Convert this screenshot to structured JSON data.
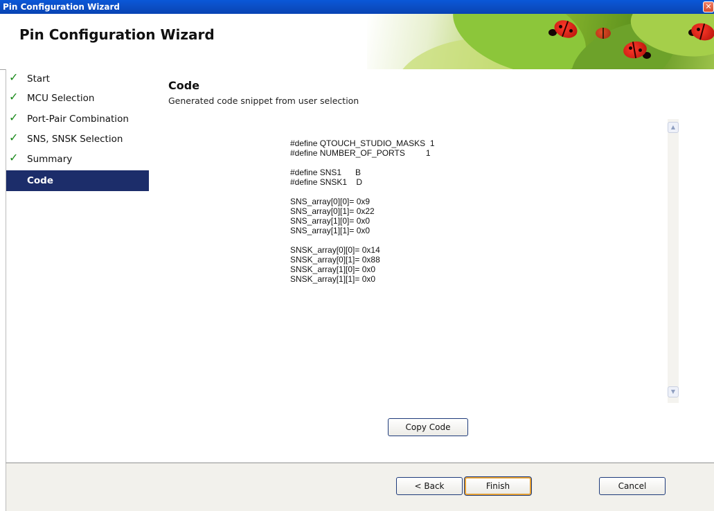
{
  "window": {
    "title": "Pin Configuration Wizard",
    "close_glyph": "✕"
  },
  "header": {
    "title": "Pin Configuration Wizard"
  },
  "nav": {
    "items": [
      {
        "label": "Start",
        "done": true
      },
      {
        "label": "MCU Selection",
        "done": true
      },
      {
        "label": "Port-Pair Combination",
        "done": true
      },
      {
        "label": "SNS, SNSK Selection",
        "done": true
      },
      {
        "label": "Summary",
        "done": true
      },
      {
        "label": "Code",
        "done": false,
        "active": true
      }
    ],
    "check_glyph": "✓",
    "active_color": "#1c2d6a"
  },
  "content": {
    "title": "Code",
    "description": "Generated code snippet from user selection",
    "code": "#define QTOUCH_STUDIO_MASKS  1\n#define NUMBER_OF_PORTS         1\n\n#define SNS1      B\n#define SNSK1    D\n\nSNS_array[0][0]= 0x9\nSNS_array[0][1]= 0x22\nSNS_array[1][0]= 0x0\nSNS_array[1][1]= 0x0\n\nSNSK_array[0][0]= 0x14\nSNSK_array[0][1]= 0x88\nSNSK_array[1][0]= 0x0\nSNSK_array[1][1]= 0x0",
    "copy_button": "Copy Code"
  },
  "footer": {
    "back_button": "< Back",
    "finish_button": "Finish",
    "cancel_button": "Cancel"
  }
}
